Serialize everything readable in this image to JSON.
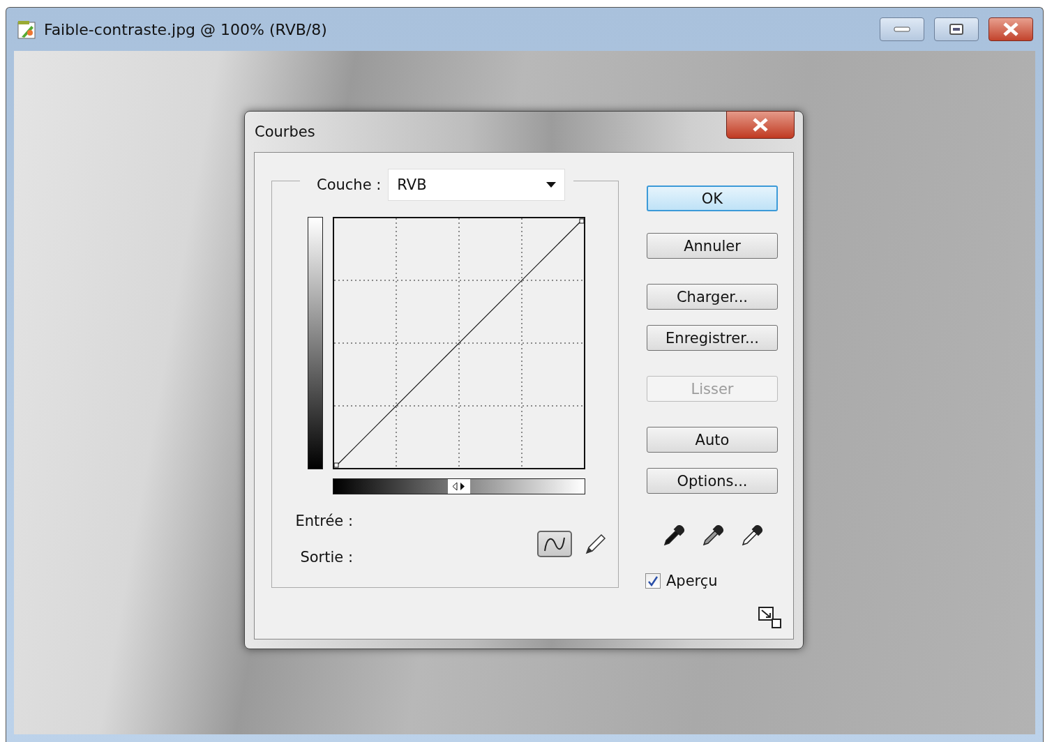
{
  "window": {
    "title": "Faible-contraste.jpg @ 100% (RVB/8)"
  },
  "dialog": {
    "title": "Courbes",
    "channel": {
      "label": "Couche :",
      "value": "RVB"
    },
    "input_label": "Entrée :",
    "output_label": "Sortie :",
    "tools": [
      {
        "kind": "curve",
        "selected": true
      },
      {
        "kind": "pencil",
        "selected": false
      }
    ],
    "buttons": [
      {
        "label": "OK",
        "default": true,
        "disabled": false
      },
      {
        "label": "Annuler",
        "default": false,
        "disabled": false
      },
      {
        "label": "Charger...",
        "default": false,
        "disabled": false
      },
      {
        "label": "Enregistrer...",
        "default": false,
        "disabled": false
      },
      {
        "label": "Lisser",
        "default": false,
        "disabled": true
      },
      {
        "label": "Auto",
        "default": false,
        "disabled": false
      },
      {
        "label": "Options...",
        "default": false,
        "disabled": false
      }
    ],
    "eyedroppers": [
      {
        "kind": "black"
      },
      {
        "kind": "gray"
      },
      {
        "kind": "white"
      }
    ],
    "preview": {
      "label": "Aperçu",
      "checked": true
    }
  }
}
